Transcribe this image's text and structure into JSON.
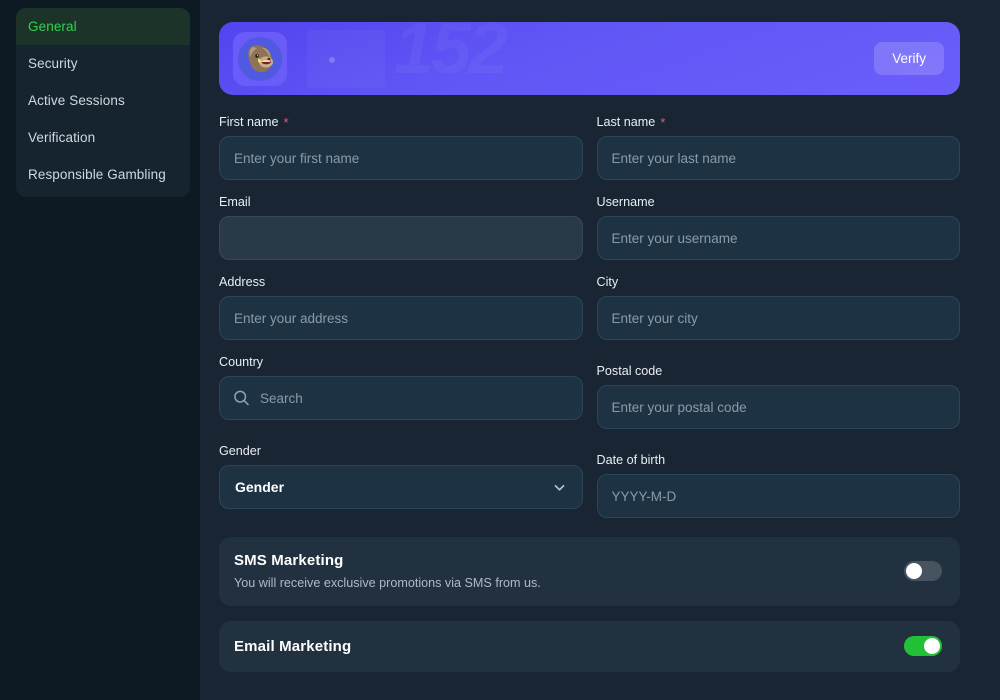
{
  "sidebar": {
    "items": [
      {
        "label": "General",
        "active": true
      },
      {
        "label": "Security",
        "active": false
      },
      {
        "label": "Active Sessions",
        "active": false
      },
      {
        "label": "Verification",
        "active": false
      },
      {
        "label": "Responsible Gambling",
        "active": false
      }
    ]
  },
  "banner": {
    "avatar_icon": "boar-avatar-icon",
    "watermark": "152",
    "verify_label": "Verify",
    "accent_color": "#6157f6"
  },
  "form": {
    "first_name": {
      "label": "First name",
      "required_mark": "*",
      "placeholder": "Enter your first name",
      "value": ""
    },
    "last_name": {
      "label": "Last name",
      "required_mark": "*",
      "placeholder": "Enter your last name",
      "value": ""
    },
    "email": {
      "label": "Email",
      "placeholder": "",
      "value": ""
    },
    "username": {
      "label": "Username",
      "placeholder": "Enter your username",
      "value": ""
    },
    "address": {
      "label": "Address",
      "placeholder": "Enter your address",
      "value": ""
    },
    "city": {
      "label": "City",
      "placeholder": "Enter your city",
      "value": ""
    },
    "country": {
      "label": "Country",
      "placeholder": "Search",
      "value": "",
      "icon": "search-icon"
    },
    "postal_code": {
      "label": "Postal code",
      "placeholder": "Enter your postal code",
      "value": ""
    },
    "gender": {
      "label": "Gender",
      "selected": "Gender",
      "icon": "chevron-down-icon"
    },
    "date_of_birth": {
      "label": "Date of birth",
      "placeholder": "YYYY-M-D",
      "value": ""
    }
  },
  "preferences": [
    {
      "title": "SMS Marketing",
      "description": "You will receive exclusive promotions via SMS from us.",
      "enabled": false
    },
    {
      "title": "Email Marketing",
      "description": "",
      "enabled": true
    }
  ],
  "colors": {
    "page_bg": "#1a2533",
    "sidebar_bg": "#0d1a24",
    "active_nav": "#2fd44b",
    "toggle_on": "#22c036",
    "required": "#e05a72"
  }
}
